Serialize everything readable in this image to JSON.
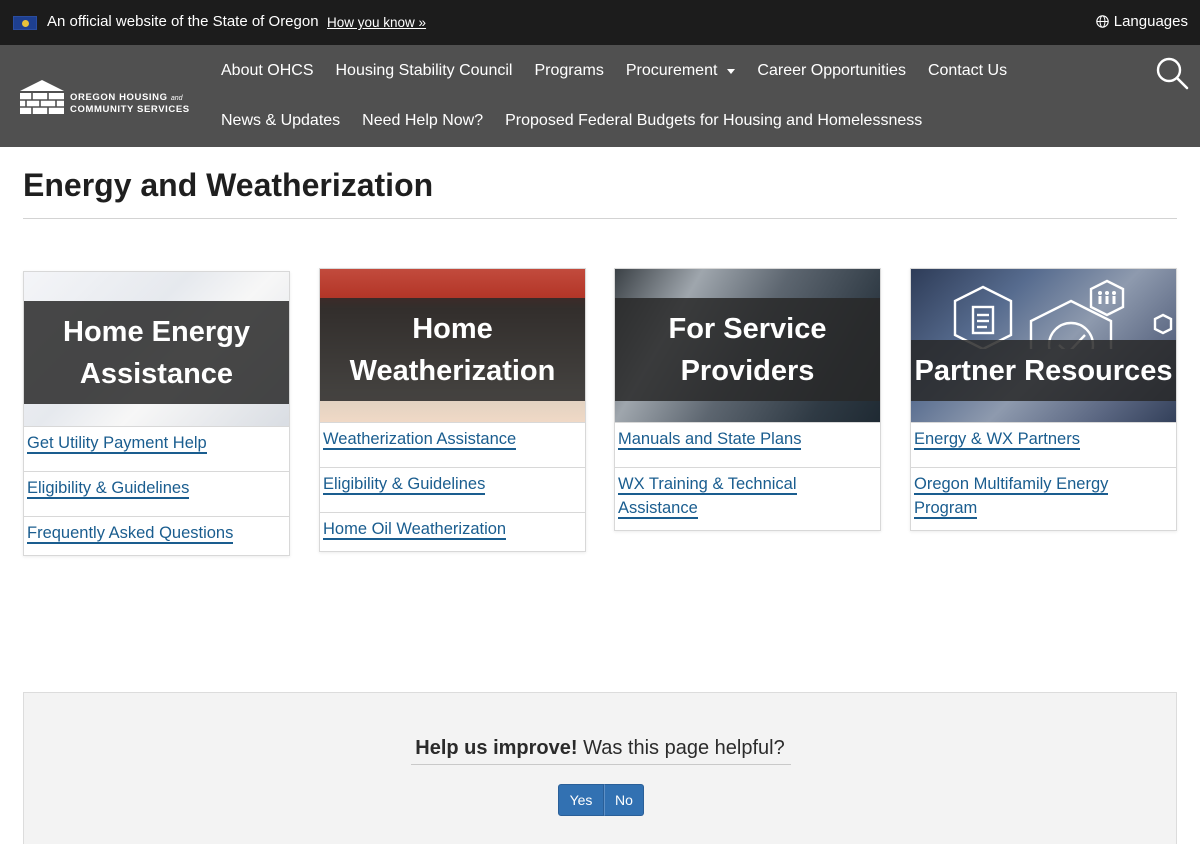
{
  "banner": {
    "text": "An official website of the State of Oregon",
    "link": "How you know »",
    "languages": "Languages"
  },
  "logo": {
    "line1": "OREGON HOUSING",
    "and": "and",
    "line2": "COMMUNITY SERVICES"
  },
  "nav": {
    "row1": [
      "About OHCS",
      "Housing Stability Council",
      "Programs",
      "Procurement",
      "Career Opportunities",
      "Contact Us"
    ],
    "row2": [
      "News & Updates",
      "Need Help Now?",
      "Proposed Federal Budgets for Housing and Homelessness"
    ]
  },
  "page": {
    "title": "Energy and Weatherization"
  },
  "cards": [
    {
      "title": "Home Energy Assistance",
      "links": [
        "Get Utility Payment Help",
        "Eligibility & Guidelines",
        "Frequently Asked Questions"
      ]
    },
    {
      "title": "Home Weatherization",
      "links": [
        "Weatherization Assistance",
        "Eligibility & Guidelines",
        "Home Oil Weatherization"
      ]
    },
    {
      "title": "For Service Providers",
      "links": [
        "Manuals and State Plans",
        "WX Training & Technical Assistance"
      ]
    },
    {
      "title": "Partner Resources",
      "links": [
        "Energy & WX Partners",
        "Oregon Multifamily Energy Program"
      ]
    }
  ],
  "feedback": {
    "bold": "Help us improve!",
    "question": " Was this page helpful?",
    "yes": "Yes",
    "no": "No"
  },
  "colors": {
    "banner": "#1c1c1c",
    "header": "#505050",
    "link": "#1a5d8f",
    "button": "#3271b2"
  }
}
